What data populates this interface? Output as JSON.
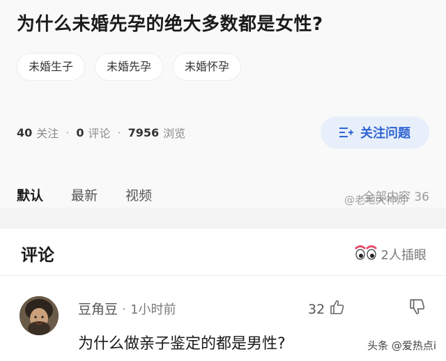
{
  "question": {
    "title": "为什么未婚先孕的绝大多数都是女性?",
    "tags": [
      "未婚生子",
      "未婚先孕",
      "未婚怀孕"
    ],
    "stats": {
      "follow_count": "40",
      "follow_label": "关注",
      "comment_count": "0",
      "comment_label": "评论",
      "view_count": "7956",
      "view_label": "浏览"
    },
    "follow_button": {
      "label": "关注问题",
      "icon": "follow-list-icon",
      "color": "#2e64d2",
      "background": "#e7effb"
    }
  },
  "tabs": {
    "items": [
      "默认",
      "最新",
      "视频"
    ],
    "all_content": "全部内容 36",
    "watermark": "@老地大神灯"
  },
  "comments": {
    "header": "评论",
    "blink_text": "2人插眼",
    "blink_icon": "eyes-icon",
    "items": [
      {
        "author": "豆角豆",
        "time": "1小时前",
        "likes": "32",
        "text": "为什么做亲子鉴定的都是男性?",
        "like_icon": "thumbs-up-icon",
        "dislike_icon": "thumbs-down-icon"
      }
    ]
  },
  "watermark": "头条 @爱热点i",
  "colors": {
    "accent": "#2e64d2",
    "card_bg": "#f9f9f9",
    "separator": "#f3f3f3"
  }
}
